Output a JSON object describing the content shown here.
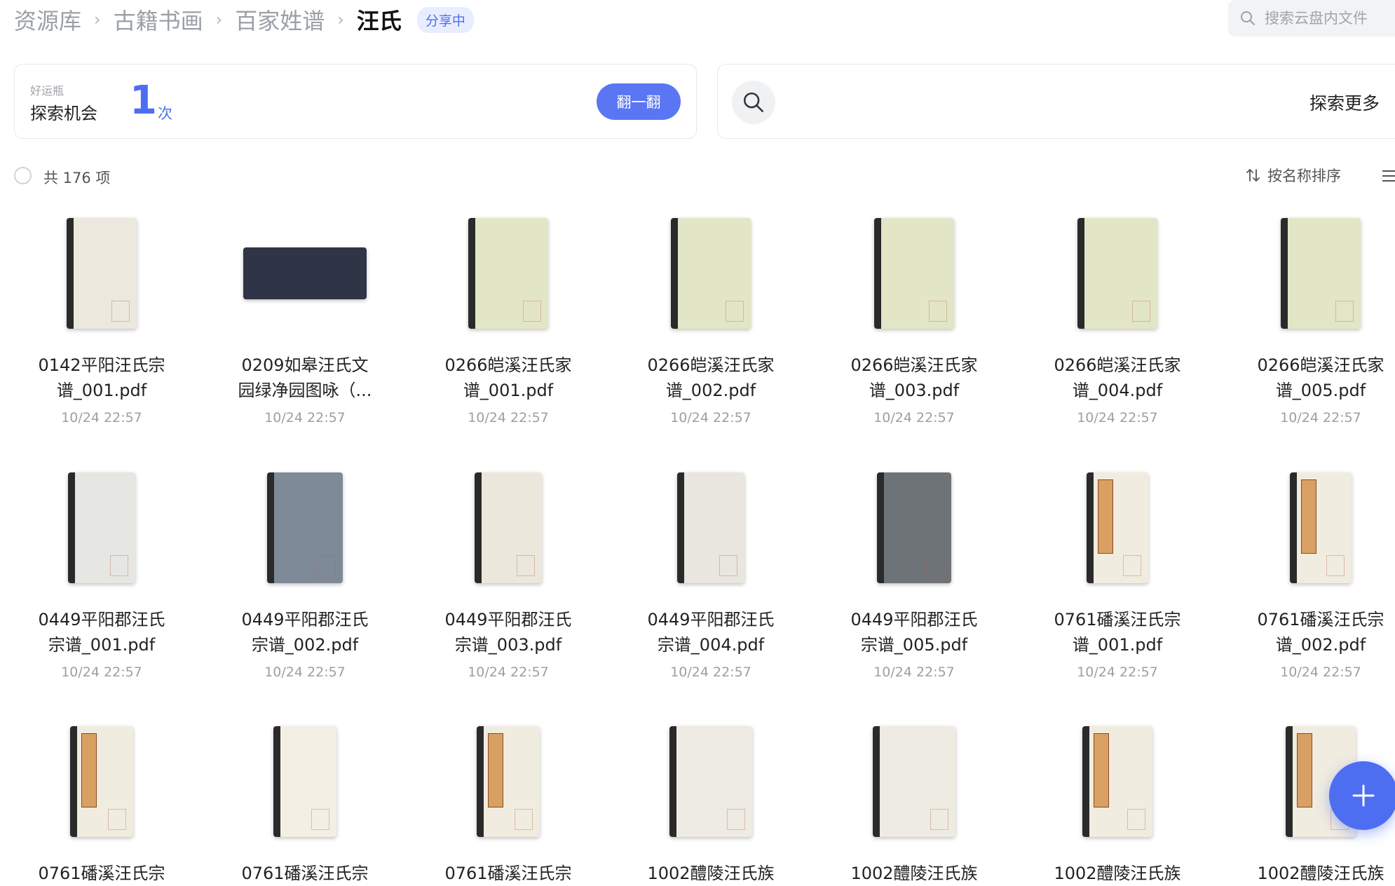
{
  "breadcrumb": {
    "items": [
      "资源库",
      "古籍书画",
      "百家姓谱"
    ],
    "current": "汪氏",
    "badge": "分享中"
  },
  "search": {
    "placeholder": "搜索云盘内文件",
    "icon": "search-icon"
  },
  "luck_card": {
    "subtitle": "好运瓶",
    "title": "探索机会",
    "count": "1",
    "unit": "次",
    "button": "翻一翻"
  },
  "explore_card": {
    "icon": "search-icon",
    "label": "探索更多"
  },
  "toolbar": {
    "count_text": "共 176 项",
    "sort_icon": "sort-arrows-icon",
    "sort_label": "按名称排序",
    "view_icon": "list-view-icon"
  },
  "files": [
    {
      "name": "0142平阳汪氏宗谱_001.pdf",
      "line1": "0142平阳汪氏宗",
      "line2": "谱_001.pdf",
      "date": "10/24 22:57"
    },
    {
      "name": "0209如皋汪氏文园绿净园图咏（...",
      "line1": "0209如皋汪氏文",
      "line2": "园绿净园图咏（...",
      "date": "10/24 22:57"
    },
    {
      "name": "0266皑溪汪氏家谱_001.pdf",
      "line1": "0266皑溪汪氏家",
      "line2": "谱_001.pdf",
      "date": "10/24 22:57"
    },
    {
      "name": "0266皑溪汪氏家谱_002.pdf",
      "line1": "0266皑溪汪氏家",
      "line2": "谱_002.pdf",
      "date": "10/24 22:57"
    },
    {
      "name": "0266皑溪汪氏家谱_003.pdf",
      "line1": "0266皑溪汪氏家",
      "line2": "谱_003.pdf",
      "date": "10/24 22:57"
    },
    {
      "name": "0266皑溪汪氏家谱_004.pdf",
      "line1": "0266皑溪汪氏家",
      "line2": "谱_004.pdf",
      "date": "10/24 22:57"
    },
    {
      "name": "0266皑溪汪氏家谱_005.pdf",
      "line1": "0266皑溪汪氏家",
      "line2": "谱_005.pdf",
      "date": "10/24 22:57"
    },
    {
      "name": "0449平阳郡汪氏宗谱_001.pdf",
      "line1": "0449平阳郡汪氏",
      "line2": "宗谱_001.pdf",
      "date": "10/24 22:57"
    },
    {
      "name": "0449平阳郡汪氏宗谱_002.pdf",
      "line1": "0449平阳郡汪氏",
      "line2": "宗谱_002.pdf",
      "date": "10/24 22:57"
    },
    {
      "name": "0449平阳郡汪氏宗谱_003.pdf",
      "line1": "0449平阳郡汪氏",
      "line2": "宗谱_003.pdf",
      "date": "10/24 22:57"
    },
    {
      "name": "0449平阳郡汪氏宗谱_004.pdf",
      "line1": "0449平阳郡汪氏",
      "line2": "宗谱_004.pdf",
      "date": "10/24 22:57"
    },
    {
      "name": "0449平阳郡汪氏宗谱_005.pdf",
      "line1": "0449平阳郡汪氏",
      "line2": "宗谱_005.pdf",
      "date": "10/24 22:57"
    },
    {
      "name": "0761磻溪汪氏宗谱_001.pdf",
      "line1": "0761磻溪汪氏宗",
      "line2": "谱_001.pdf",
      "date": "10/24 22:57"
    },
    {
      "name": "0761磻溪汪氏宗谱_002.pdf",
      "line1": "0761磻溪汪氏宗",
      "line2": "谱_002.pdf",
      "date": "10/24 22:57"
    },
    {
      "name": "0761磻溪汪氏宗",
      "line1": "0761磻溪汪氏宗",
      "line2": "",
      "date": ""
    },
    {
      "name": "0761磻溪汪氏宗",
      "line1": "0761磻溪汪氏宗",
      "line2": "",
      "date": ""
    },
    {
      "name": "0761磻溪汪氏宗",
      "line1": "0761磻溪汪氏宗",
      "line2": "",
      "date": ""
    },
    {
      "name": "1002醴陵汪氏族",
      "line1": "1002醴陵汪氏族",
      "line2": "",
      "date": ""
    },
    {
      "name": "1002醴陵汪氏族",
      "line1": "1002醴陵汪氏族",
      "line2": "",
      "date": ""
    },
    {
      "name": "1002醴陵汪氏族",
      "line1": "1002醴陵汪氏族",
      "line2": "",
      "date": ""
    },
    {
      "name": "1002醴陵汪氏族",
      "line1": "1002醴陵汪氏族",
      "line2": "",
      "date": ""
    }
  ],
  "thumb_colors": [
    "#ece8de",
    "#2f3446",
    "#e3e6c6",
    "#e3e6c6",
    "#e3e6c6",
    "#e3e6c6",
    "#e3e6c6",
    "#e6e7e2",
    "#7f8a98",
    "#ebe7dc",
    "#e9e6df",
    "#6e7377",
    "#f1ece0",
    "#f1ece0",
    "#f1ece0",
    "#f3efe4",
    "#f1ece0",
    "#eeebe2",
    "#eeebe2",
    "#f1ece0",
    "#f1ece0"
  ],
  "fab_icon": "plus-icon"
}
